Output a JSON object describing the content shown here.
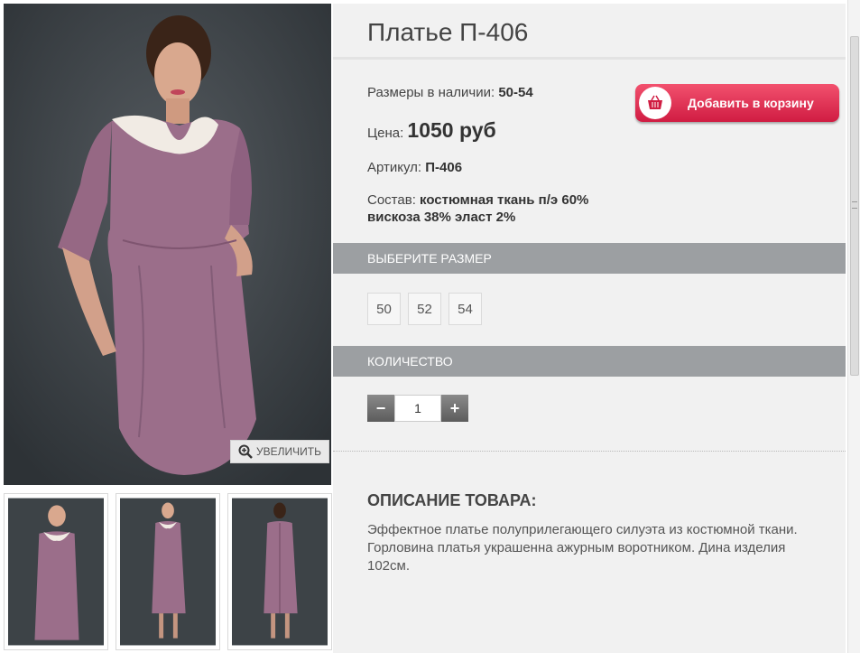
{
  "product": {
    "title": "Платье П-406",
    "sizes_label": "Размеры в наличии:",
    "sizes_value": "50-54",
    "price_label": "Цена:",
    "price_value": "1050 руб",
    "article_label": "Артикул:",
    "article_value": "П-406",
    "composition_label": "Состав:",
    "composition_line1": "костюмная ткань п/э 60%",
    "composition_line2": "вискоза 38% эласт 2%"
  },
  "cart_button": {
    "label": "Добавить в корзину",
    "icon": "basket-icon",
    "color": "#e0304f"
  },
  "size_section": {
    "heading": "ВЫБЕРИТЕ РАЗМЕР",
    "options": [
      "50",
      "52",
      "54"
    ]
  },
  "quantity_section": {
    "heading": "КОЛИЧЕСТВО",
    "minus": "−",
    "plus": "+",
    "value": "1"
  },
  "zoom": {
    "label": "УВЕЛИЧИТЬ",
    "icon": "magnifier-plus-icon"
  },
  "description": {
    "heading": "ОПИСАНИЕ ТОВАРА:",
    "text": "Эффектное платье полуприлегающего силуэта из костюмной ткани. Горловина платья украшенна ажурным воротником. Дина изделия 102см."
  },
  "colors": {
    "dress": "#9b6e8a",
    "photo_bg": "#3d4347",
    "section_bar": "#9c9fa2"
  }
}
